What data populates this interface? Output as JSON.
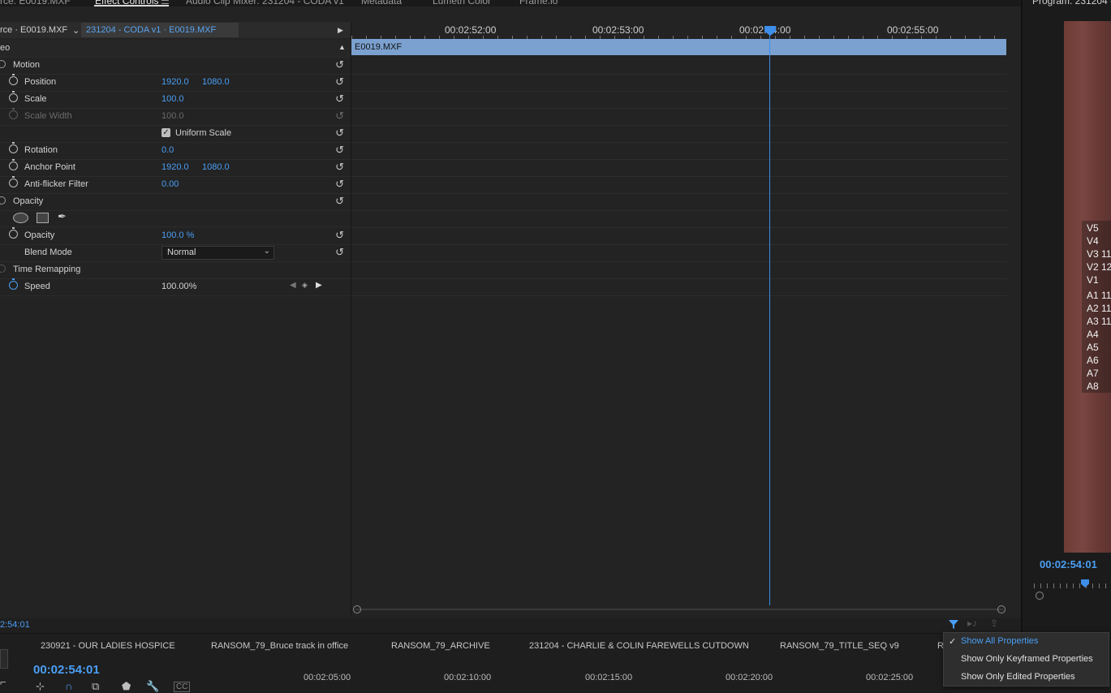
{
  "tabs": {
    "source": "rce: E0019.MXF",
    "effect_controls": "Effect Controls",
    "menu_glyph": "☰",
    "audio_clip_mixer": "Audio Clip Mixer: 231204 - CODA v1",
    "metadata": "Metadata",
    "lumetri": "Lumetri Color",
    "frameio": "Frame.io",
    "program": "Program: 231204 -"
  },
  "source_bar": {
    "master": "rce · E0019.MXF",
    "sequence": "231204 - CODA v1 · E0019.MXF"
  },
  "section": "eo",
  "effects": {
    "motion": "Motion",
    "position_label": "Position",
    "position_x": "1920.0",
    "position_y": "1080.0",
    "scale_label": "Scale",
    "scale_value": "100.0",
    "scale_width_label": "Scale Width",
    "scale_width_value": "100.0",
    "uniform_scale": "Uniform Scale",
    "rotation_label": "Rotation",
    "rotation_value": "0.0",
    "anchor_label": "Anchor Point",
    "anchor_x": "1920.0",
    "anchor_y": "1080.0",
    "antiflicker_label": "Anti-flicker Filter",
    "antiflicker_value": "0.00",
    "opacity_group": "Opacity",
    "opacity_label": "Opacity",
    "opacity_value": "100.0 %",
    "blend_label": "Blend Mode",
    "blend_value": "Normal",
    "time_remap": "Time Remapping",
    "speed_label": "Speed",
    "speed_value": "100.00%"
  },
  "timeline": {
    "ruler": [
      "00:02:52:00",
      "00:02:53:00",
      "00:02:54:00",
      "00:02:55:00"
    ],
    "clip_name": "E0019.MXF",
    "current_tc": "2:54:01"
  },
  "sequences": {
    "tabs": [
      "230921 - OUR LADIES HOSPICE",
      "RANSOM_79_Bruce track in office",
      "RANSOM_79_ARCHIVE",
      "231204 - CHARLIE & COLIN FAREWELLS CUTDOWN",
      "RANSOM_79_TITLE_SEQ v9",
      "R"
    ],
    "timecode": "00:02:54:01",
    "ruler": [
      "00:02:05:00",
      "00:02:10:00",
      "00:02:15:00",
      "00:02:20:00",
      "00:02:25:00"
    ]
  },
  "program": {
    "tracks": [
      "V5",
      "V4",
      "V3 11",
      "V2 12",
      "V1",
      "A1 11",
      "A2 11",
      "A3 11",
      "A4",
      "A5",
      "A6",
      "A7",
      "A8"
    ],
    "timecode": "00:02:54:01"
  },
  "filter_menu": {
    "items": [
      "Show All Properties",
      "Show Only Keyframed Properties",
      "Show Only Edited Properties"
    ],
    "selected": "Show All Properties"
  },
  "colors": {
    "accent_blue": "#4a9ff5",
    "clip_blue": "#7ba1d0",
    "panel_bg": "#232323"
  }
}
